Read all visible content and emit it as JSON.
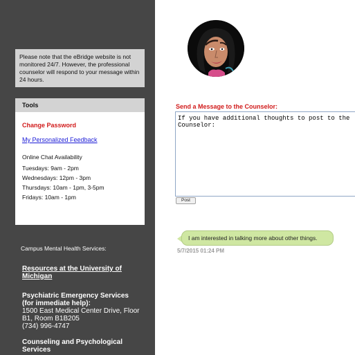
{
  "notice": {
    "text": "Please note that the eBridge website is not monitored 24/7. However, the professional counselor will respond to your message within 24 hours."
  },
  "tools": {
    "header": "Tools",
    "change_password": "Change Password",
    "feedback_link": "My Personalized Feedback",
    "availability_title": "Online Chat Availability",
    "availability": [
      "Tuesdays: 9am - 2pm",
      "Wednesdays: 12pm - 3pm",
      "Thursdays: 10am - 1pm, 3-5pm",
      "Fridays: 10am - 1pm"
    ]
  },
  "campus": {
    "title": "Campus Mental Health Services:",
    "resources_link": "Resources at the University of Michigan",
    "psych_emergency": {
      "name": "Psychiatric Emergency Services (for immediate help):",
      "address": "1500 East Medical Center Drive, Floor B1, Room B1B205",
      "phone": "(734) 996-4747"
    },
    "caps": {
      "name": "Counseling and Psychological Services"
    }
  },
  "message": {
    "label": "Send a Message to the Counselor:",
    "placeholder": "If you have additional thoughts to post to the Counselor:",
    "post_button": "Post"
  },
  "conversation": [
    {
      "text": "I am interested in talking more about other things.",
      "timestamp": "5/7/2015 01:24 PM"
    }
  ],
  "colors": {
    "sidebar": "#464646",
    "accent_red": "#d11a1a",
    "bubble": "#cfe7a2"
  }
}
